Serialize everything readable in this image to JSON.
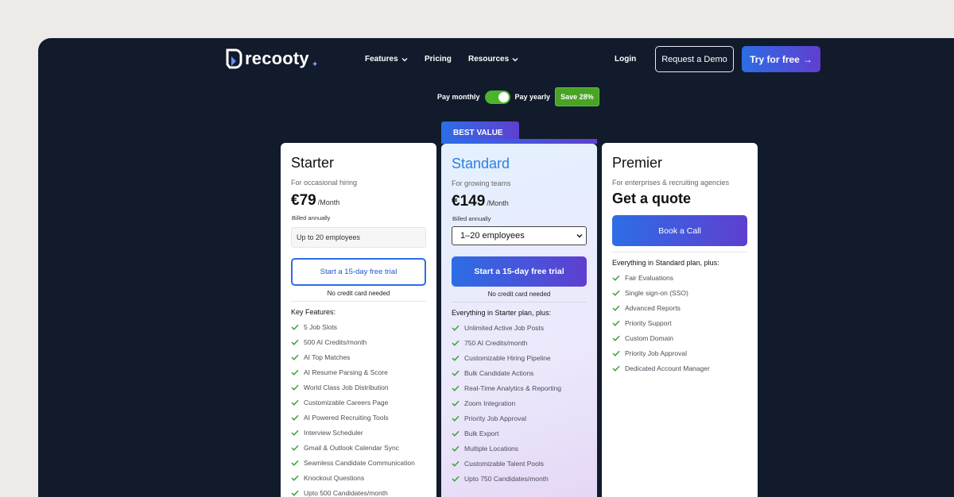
{
  "nav": {
    "logo": "recooty",
    "features": "Features",
    "pricing": "Pricing",
    "resources": "Resources",
    "login": "Login",
    "demo": "Request a Demo",
    "try": "Try for free",
    "try_arrow": "→"
  },
  "billing": {
    "monthly": "Pay monthly",
    "yearly": "Pay yearly",
    "save": "Save 28%",
    "yearly_selected": true
  },
  "best_value": "BEST VALUE",
  "plans": {
    "starter": {
      "name": "Starter",
      "sub": "For occasional hiring",
      "price": "€79",
      "per": "/Month",
      "billed": "Billed annually",
      "employees": "Up to 20 employees",
      "cta": "Start a 15-day free trial",
      "no_cc": "No credit card needed",
      "features_head": "Key Features:",
      "features": [
        "5 Job Slots",
        "500 AI Credits/month",
        "AI Top Matches",
        "AI Resume Parsing & Score",
        "World Class Job Distribution",
        "Customizable Careers Page",
        "AI Powered Recruiting Tools",
        "Interview Scheduler",
        "Gmail & Outlook Calendar Sync",
        "Seamless Candidate Communication",
        "Knockout Questions",
        "Upto 500 Candidates/month"
      ]
    },
    "standard": {
      "name": "Standard",
      "sub": "For growing teams",
      "price": "€149",
      "per": "/Month",
      "billed": "Billed annually",
      "employees": "1–20 employees",
      "cta": "Start a 15-day free trial",
      "no_cc": "No credit card needed",
      "features_head": "Everything in Starter plan, plus:",
      "features": [
        "Unlimited Active Job Posts",
        "750 AI Credits/month",
        "Customizable Hiring Pipeline",
        "Bulk Candidate Actions",
        "Real-Time Analytics & Reporting",
        "Zoom Integration",
        "Priority Job Approval",
        "Bulk Export",
        "Multiple Locations",
        "Customizable Talent Pools",
        "Upto 750 Candidates/month"
      ]
    },
    "premier": {
      "name": "Premier",
      "sub": "For enterprises & recruiting agencies",
      "quote": "Get a quote",
      "cta": "Book a Call",
      "features_head": "Everything in Standard plan, plus:",
      "features": [
        "Fair Evaluations",
        "Single sign-on (SSO)",
        "Advanced Reports",
        "Priority Support",
        "Custom Domain",
        "Priority Job Approval",
        "Dedicated Account Manager"
      ]
    }
  },
  "colors": {
    "background": "#111b2b",
    "accent_start": "#2d6de6",
    "accent_end": "#5f3fd0",
    "check": "#3aa335",
    "save_badge": "#49a324"
  }
}
